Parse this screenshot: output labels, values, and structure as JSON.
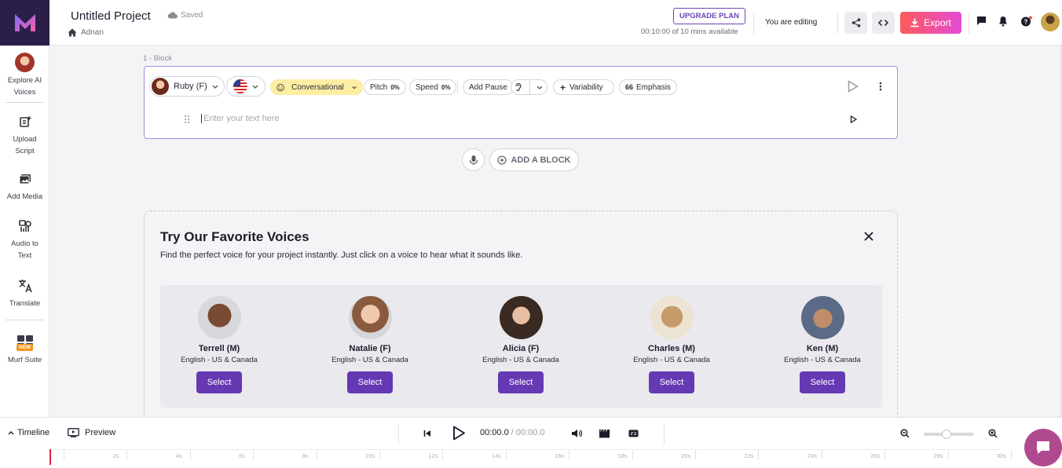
{
  "sidebar": {
    "items": [
      {
        "label": "Explore AI Voices",
        "icon": "voice-avatar-icon"
      },
      {
        "label": "Upload Script",
        "icon": "upload-script-icon"
      },
      {
        "label": "Add Media",
        "icon": "media-icon"
      },
      {
        "label": "Audio to Text",
        "icon": "audio-to-text-icon"
      },
      {
        "label": "Translate",
        "icon": "translate-icon"
      },
      {
        "label": "Murf Suite",
        "icon": "grid-icon",
        "badge": "NEW"
      }
    ]
  },
  "header": {
    "title": "Untitled Project",
    "saved": "Saved",
    "breadcrumb": "Adnan",
    "upgrade": "UPGRADE PLAN",
    "minutes": "00:10:00 of 10 mins available",
    "editing": "You are editing",
    "export": "Export"
  },
  "block": {
    "label": "1 -  Block",
    "voice": "Ruby (F)",
    "style": "Conversational",
    "pitch_label": "Pitch",
    "pitch_value": "0%",
    "speed_label": "Speed",
    "speed_value": "0%",
    "add_pause": "Add Pause",
    "variability": "Variability",
    "emphasis": "Emphasis",
    "placeholder": "Enter your text here"
  },
  "add_block": "ADD A BLOCK",
  "favorites": {
    "title": "Try Our Favorite Voices",
    "description": "Find the perfect voice for your project instantly. Just click on a voice to hear what it sounds like.",
    "voices": [
      {
        "name": "Terrell (M)",
        "lang": "English - US & Canada",
        "select": "Select",
        "color": "#7a4b33"
      },
      {
        "name": "Natalie (F)",
        "lang": "English - US & Canada",
        "select": "Select",
        "color": "#8a5a3e"
      },
      {
        "name": "Alicia (F)",
        "lang": "English - US & Canada",
        "select": "Select",
        "color": "#3a2a22"
      },
      {
        "name": "Charles (M)",
        "lang": "English - US & Canada",
        "select": "Select",
        "color": "#c79a6a"
      },
      {
        "name": "Ken (M)",
        "lang": "English - US & Canada",
        "select": "Select",
        "color": "#5b6a86"
      }
    ]
  },
  "bottom": {
    "timeline": "Timeline",
    "preview": "Preview",
    "time_current": "00:00.0",
    "time_total": " / 00:00.0",
    "ruler": [
      "2s",
      "4s",
      "6s",
      "8s",
      "10s",
      "12s",
      "14s",
      "16s",
      "18s",
      "20s",
      "22s",
      "24s",
      "26s",
      "28s",
      "30s"
    ]
  },
  "colors": {
    "brand_purple": "#6539b3",
    "export_gradient_start": "#fc5a5a",
    "export_gradient_end": "#e44bd4",
    "logo_bg": "#2b1f4a"
  }
}
